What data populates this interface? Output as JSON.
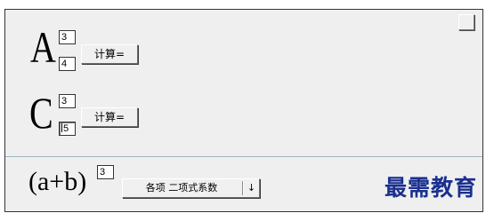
{
  "panel_a": {
    "letter": "A",
    "superscript_value": "3",
    "subscript_value": "4",
    "calc_label": "计算="
  },
  "panel_c": {
    "letter": "C",
    "superscript_value": "3",
    "subscript_value": "5",
    "calc_label": "计算="
  },
  "binomial": {
    "expression": "(a+b)",
    "exponent_value": "3",
    "select_selected": "各项 二项式系数",
    "select_arrow": "↓"
  },
  "watermark": {
    "text": "最需教育"
  },
  "colors": {
    "panel_bg": "#efefef",
    "divider": "#9fb6c9",
    "watermark": "#1a2f8f"
  }
}
